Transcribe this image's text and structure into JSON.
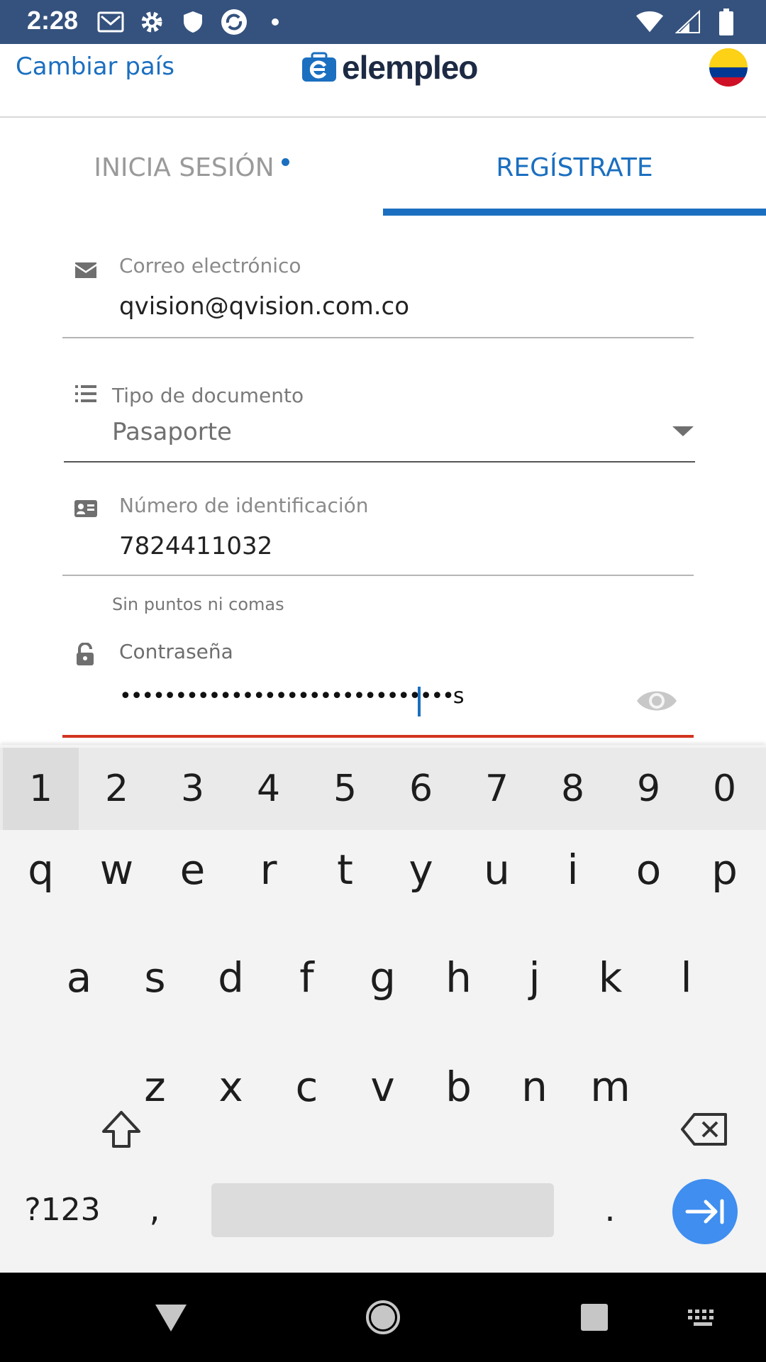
{
  "status_bar": {
    "time": "2:28",
    "left_icons": [
      "gmail-icon",
      "settings-icon",
      "shield-icon",
      "sync-icon",
      "notification-dot-icon"
    ],
    "right_icons": [
      "wifi-icon",
      "signal-icon",
      "battery-icon"
    ],
    "background": "#35527e"
  },
  "header": {
    "change_country": "Cambiar país",
    "logo_text": "elempleo",
    "flag": "colombia-flag-icon"
  },
  "tabs": {
    "login": "INICIA SESIÓN",
    "register": "REGÍSTRATE",
    "active": "register",
    "accent": "#1b6fc0"
  },
  "form": {
    "email": {
      "label": "Correo electrónico",
      "value": "qvision@qvision.com.co",
      "icon": "envelope-icon"
    },
    "doc_type": {
      "label": "Tipo de documento",
      "value": "Pasaporte",
      "icon": "list-icon"
    },
    "id_number": {
      "label": "Número de identificación",
      "value": "7824411032",
      "helper": "Sin puntos ni comas",
      "icon": "id-card-icon"
    },
    "password": {
      "label": "Contraseña",
      "value": "••••••••••••••••••••••••••••••s",
      "icon": "lock-icon",
      "error_color": "#d2331f"
    }
  },
  "keyboard": {
    "numbers": [
      "1",
      "2",
      "3",
      "4",
      "5",
      "6",
      "7",
      "8",
      "9",
      "0"
    ],
    "row1": [
      "q",
      "w",
      "e",
      "r",
      "t",
      "y",
      "u",
      "i",
      "o",
      "p"
    ],
    "row2": [
      "a",
      "s",
      "d",
      "f",
      "g",
      "h",
      "j",
      "k",
      "l"
    ],
    "row3": [
      "z",
      "x",
      "c",
      "v",
      "b",
      "n",
      "m"
    ],
    "symbols_key": "?123",
    "comma": ",",
    "period": "."
  }
}
